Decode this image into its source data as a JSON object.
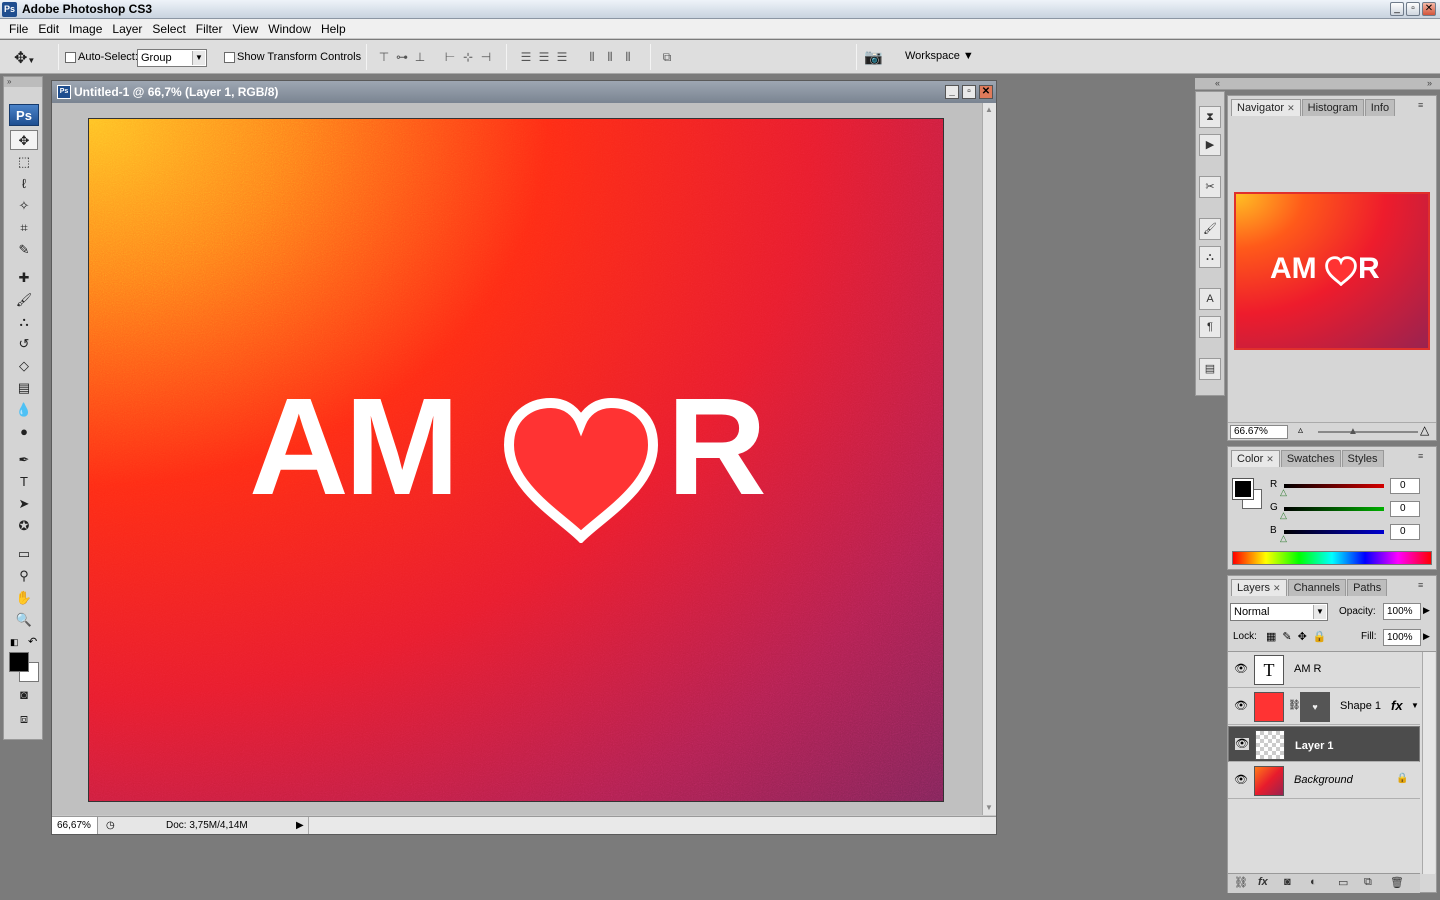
{
  "window": {
    "title": "Adobe Photoshop CS3",
    "app_icon": "Ps"
  },
  "menu": [
    "File",
    "Edit",
    "Image",
    "Layer",
    "Select",
    "Filter",
    "View",
    "Window",
    "Help"
  ],
  "options_bar": {
    "auto_select_label": "Auto-Select:",
    "auto_select_value": "Group",
    "show_transform_label": "Show Transform Controls",
    "workspace_label": "Workspace ▼"
  },
  "toolbox": {
    "logo": "Ps"
  },
  "document": {
    "title": "Untitled-1 @ 66,7% (Layer 1, RGB/8)",
    "text_left": "AM",
    "text_right": "R",
    "zoom": "66,67%",
    "doc_info": "Doc: 3,75M/4,14M",
    "art_colors": {
      "heart": "#ff3333",
      "text": "#ffffff"
    }
  },
  "navigator": {
    "tabs": [
      "Navigator",
      "Histogram",
      "Info"
    ],
    "zoom": "66.67%",
    "thumb_text_left": "AM",
    "thumb_text_right": "R"
  },
  "color_panel": {
    "tabs": [
      "Color",
      "Swatches",
      "Styles"
    ],
    "channels": [
      {
        "label": "R",
        "value": "0",
        "color": "#d40000"
      },
      {
        "label": "G",
        "value": "0",
        "color": "#00b000"
      },
      {
        "label": "B",
        "value": "0",
        "color": "#0000d0"
      }
    ],
    "foreground": "#000000",
    "background": "#ffffff"
  },
  "layers_panel": {
    "tabs": [
      "Layers",
      "Channels",
      "Paths"
    ],
    "blend_mode": "Normal",
    "opacity_label": "Opacity:",
    "opacity": "100%",
    "lock_label": "Lock:",
    "fill_label": "Fill:",
    "fill": "100%",
    "layers": [
      {
        "name": "AM  R",
        "thumb": "T"
      },
      {
        "name": "Shape 1",
        "fx": "fx"
      },
      {
        "name": "Layer 1"
      },
      {
        "name": "Background"
      }
    ]
  }
}
